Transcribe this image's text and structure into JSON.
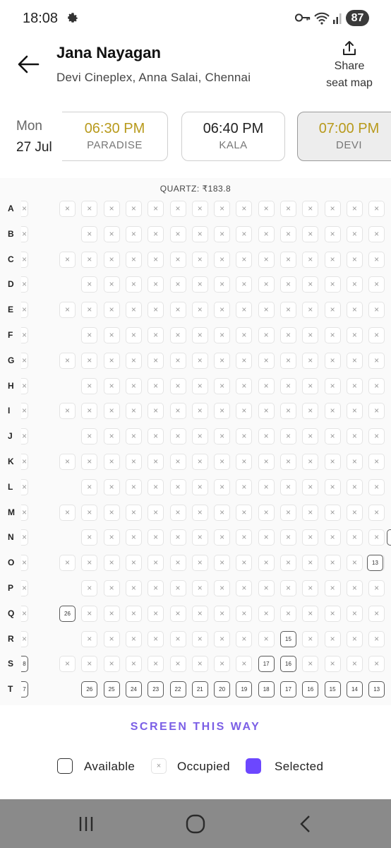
{
  "status_bar": {
    "time": "18:08",
    "battery": "87",
    "icons": [
      "gear-icon",
      "key-icon",
      "wifi-icon",
      "signal-icon",
      "battery-icon"
    ]
  },
  "header": {
    "title": "Jana Nayagan",
    "cinema": "Devi Cineplex, Anna Salai, Chennai",
    "share_line1": "Share",
    "share_line2": "seat map"
  },
  "date": {
    "day": "Mon",
    "date": "27 Jul"
  },
  "showtimes": [
    {
      "time": "06:30 PM",
      "screen": "PARADISE",
      "time_color": "#b89a1c",
      "selected": false
    },
    {
      "time": "06:40 PM",
      "screen": "KALA",
      "time_color": "#222222",
      "selected": false
    },
    {
      "time": "07:00 PM",
      "screen": "DEVI",
      "time_color": "#b89a1c",
      "selected": true
    }
  ],
  "seat_map": {
    "category_label": "QUARTZ: ₹183.8",
    "rows": [
      {
        "label": "A",
        "has_left_seat": true
      },
      {
        "label": "B",
        "has_left_seat": false
      },
      {
        "label": "C",
        "has_left_seat": true
      },
      {
        "label": "D",
        "has_left_seat": false
      },
      {
        "label": "E",
        "has_left_seat": true
      },
      {
        "label": "F",
        "has_left_seat": false
      },
      {
        "label": "G",
        "has_left_seat": true
      },
      {
        "label": "H",
        "has_left_seat": false
      },
      {
        "label": "I",
        "has_left_seat": true
      },
      {
        "label": "J",
        "has_left_seat": false
      },
      {
        "label": "K",
        "has_left_seat": true
      },
      {
        "label": "L",
        "has_left_seat": false
      },
      {
        "label": "M",
        "has_left_seat": true
      },
      {
        "label": "N",
        "has_left_seat": false
      },
      {
        "label": "O",
        "has_left_seat": true
      },
      {
        "label": "P",
        "has_left_seat": false
      },
      {
        "label": "Q",
        "has_left_seat": true,
        "avail": {
          "0": "26"
        }
      },
      {
        "label": "R",
        "has_left_seat": false,
        "avail": {
          "10": "15"
        }
      },
      {
        "label": "S",
        "has_left_seat": true,
        "avail": {
          "9": "17",
          "10": "16"
        },
        "edge": "8"
      },
      {
        "label": "T",
        "has_left_seat": false,
        "edge": "7",
        "avail": {
          "1": "26",
          "2": "25",
          "3": "24",
          "4": "23",
          "5": "22",
          "6": "21",
          "7": "20",
          "8": "19",
          "9": "18",
          "10": "17",
          "11": "16",
          "12": "15",
          "13": "14",
          "14": "13"
        }
      }
    ],
    "extra_right": {
      "N": "",
      "O": "13"
    }
  },
  "screen_label": "SCREEN THIS WAY",
  "legend": {
    "available": "Available",
    "occupied": "Occupied",
    "selected": "Selected",
    "selected_color": "#6c47ff"
  },
  "nav": [
    "recent-apps-icon",
    "home-icon",
    "back-icon"
  ]
}
